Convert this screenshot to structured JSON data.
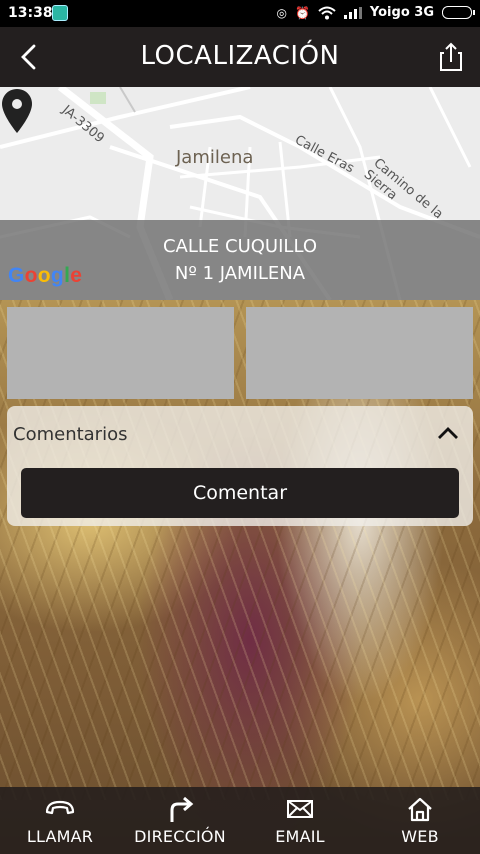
{
  "status": {
    "time": "13:38",
    "carrier": "Yoigo 3G"
  },
  "header": {
    "title": "LOCALIZACIÓN"
  },
  "map": {
    "road_labels": [
      "JA-3309",
      "Calle Eras",
      "Camino de la Sierra"
    ],
    "town": "Jamilena",
    "provider": "Google",
    "address_line1": "CALLE CUQUILLO",
    "address_line2": "Nº 1 JAMILENA"
  },
  "comments": {
    "label": "Comentarios",
    "button": "Comentar"
  },
  "bottom_nav": {
    "call": "LLAMAR",
    "direction": "DIRECCIÓN",
    "email": "EMAIL",
    "web": "WEB"
  },
  "colors": {
    "bar": "#231f1f",
    "tile": "#b3b3b3",
    "address_overlay": "#696969"
  }
}
